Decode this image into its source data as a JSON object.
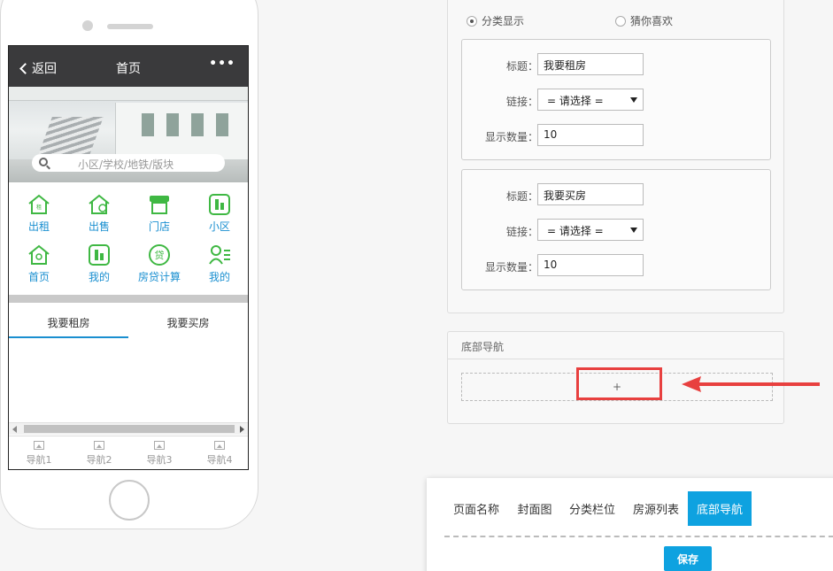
{
  "mobile": {
    "header": {
      "back_label": "返回",
      "title": "首页",
      "more_label": "•••"
    },
    "search": {
      "placeholder": "小区/学校/地铁/版块"
    },
    "grid": [
      {
        "label": "出租",
        "icon": "rent-house-icon"
      },
      {
        "label": "出售",
        "icon": "sale-house-icon"
      },
      {
        "label": "门店",
        "icon": "store-icon"
      },
      {
        "label": "小区",
        "icon": "building-icon"
      },
      {
        "label": "首页",
        "icon": "home-icon"
      },
      {
        "label": "我的",
        "icon": "building-icon"
      },
      {
        "label": "房贷计算",
        "icon": "loan-icon"
      },
      {
        "label": "我的",
        "icon": "user-list-icon"
      }
    ],
    "tabs": [
      "我要租房",
      "我要买房"
    ],
    "bottom_nav": [
      "导航1",
      "导航2",
      "导航3",
      "导航4"
    ],
    "accent_color": "#1a8fd0",
    "icon_color": "#3fb843"
  },
  "settings": {
    "radios": [
      {
        "label": "分类显示",
        "checked": true
      },
      {
        "label": "猜你喜欢",
        "checked": false
      }
    ],
    "groups": [
      {
        "title_label": "标题：",
        "title_value": "我要租房",
        "link_label": "链接：",
        "link_value": "= 请选择 =",
        "count_label": "显示数量：",
        "count_value": "10"
      },
      {
        "title_label": "标题：",
        "title_value": "我要买房",
        "link_label": "链接：",
        "link_value": "= 请选择 =",
        "count_label": "显示数量：",
        "count_value": "10"
      }
    ],
    "footer_nav": {
      "title": "底部导航",
      "add_label": "+"
    }
  },
  "card": {
    "tabs": [
      {
        "label": "页面名称",
        "active": false
      },
      {
        "label": "封面图",
        "active": false
      },
      {
        "label": "分类栏位",
        "active": false
      },
      {
        "label": "房源列表",
        "active": false
      },
      {
        "label": "底部导航",
        "active": true
      }
    ],
    "save_label": "保存",
    "accent_color": "#0ea2e0"
  },
  "annotation_color": "#e8403f"
}
